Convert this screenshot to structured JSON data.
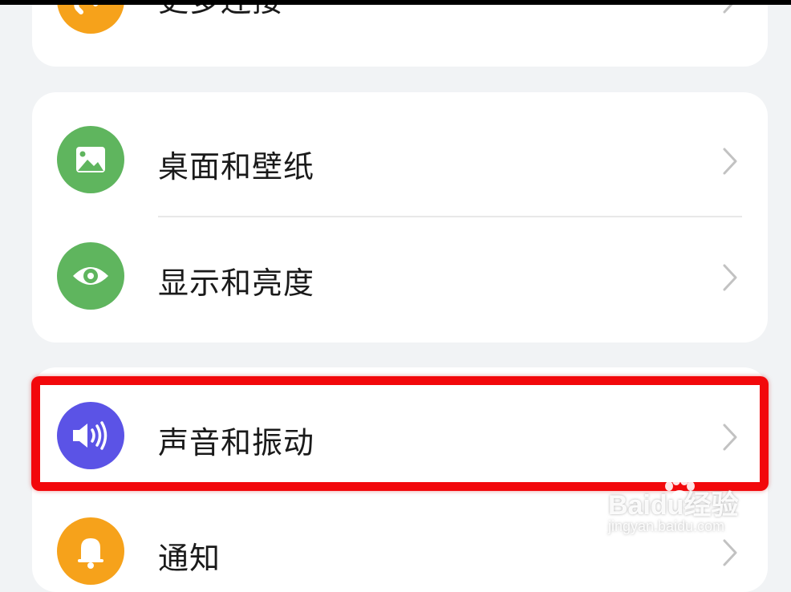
{
  "colors": {
    "background": "#f1f3f5",
    "card": "#ffffff",
    "orange": "#f6a21b",
    "green": "#5fb55e",
    "purple": "#5b53e6",
    "highlight": "#f2080b",
    "text": "#1a1a1a",
    "chevron": "#c2c2c2"
  },
  "settings": {
    "more_connections": {
      "label": "更多连接",
      "icon": "link-icon"
    },
    "desktop_wallpaper": {
      "label": "桌面和壁纸",
      "icon": "image-icon"
    },
    "display_brightness": {
      "label": "显示和亮度",
      "icon": "eye-icon"
    },
    "sound_vibration": {
      "label": "声音和振动",
      "icon": "speaker-icon"
    },
    "notifications": {
      "label": "通知",
      "icon": "bell-icon"
    }
  },
  "watermark": {
    "main": "Baidu经验",
    "sub": "jingyan.baidu.com"
  }
}
